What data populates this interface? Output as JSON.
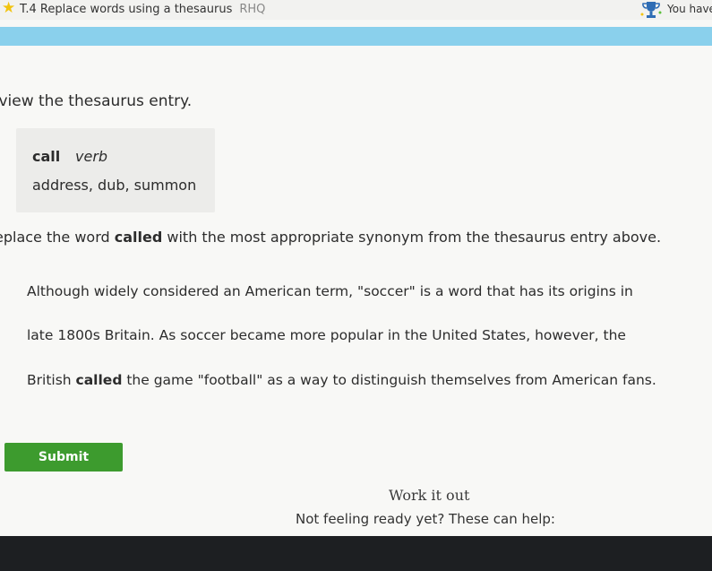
{
  "header": {
    "skill_title": "T.4 Replace words using a thesaurus",
    "skill_code": "RHQ",
    "score_label": "You have"
  },
  "question": {
    "instruction_1": "eview the thesaurus entry.",
    "thesaurus": {
      "word": "call",
      "part_of_speech": "verb",
      "synonyms": "address, dub, summon"
    },
    "instruction_2": {
      "before": "eplace the word ",
      "target": "called",
      "after": " with the most appropriate synonym from the thesaurus entry above."
    },
    "passage": {
      "line1": "Although widely considered an American term, \"soccer\" is a word that has its origins in",
      "line2": "late 1800s Britain. As soccer became more popular in the United States, however, the",
      "line3_before": "British ",
      "line3_target": "called",
      "line3_after": " the game \"football\" as a way to distinguish themselves from American fans."
    }
  },
  "actions": {
    "submit_label": "Submit",
    "work_it_out": "Work it out",
    "not_ready": "Not feeling ready yet? These can help:"
  },
  "colors": {
    "progress_band": "#8ad0ec",
    "submit_bg": "#3d9b2e",
    "star": "#f2c40f"
  }
}
